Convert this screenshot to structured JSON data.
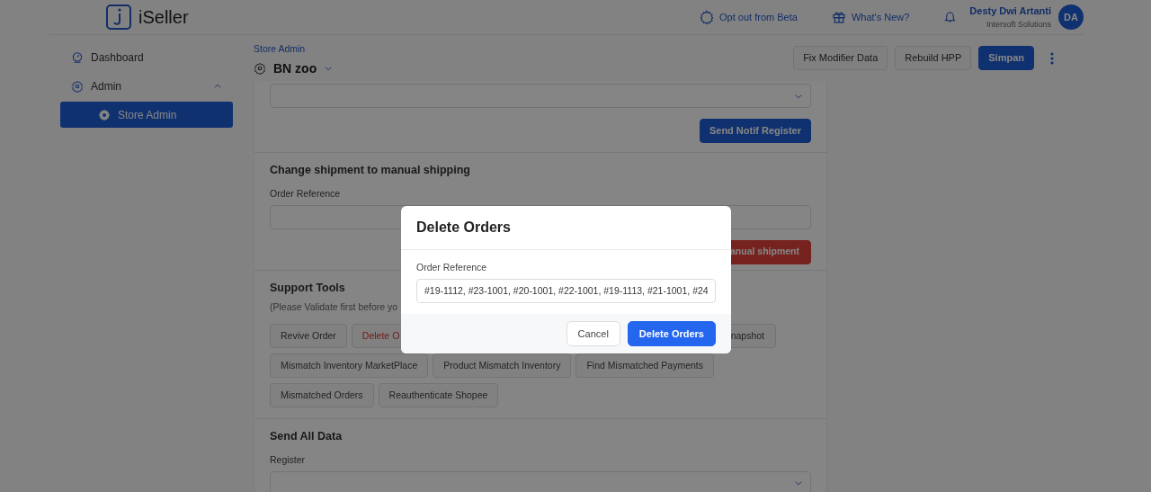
{
  "brand": {
    "name": "iSeller"
  },
  "topbar": {
    "links": [
      {
        "label": "Opt out from Beta"
      },
      {
        "label": "What's New?"
      }
    ],
    "user": {
      "name": "Desty Dwi Artanti",
      "company": "Intersoft Solutions",
      "initials": "DA"
    }
  },
  "sidebar": {
    "items": [
      {
        "label": "Dashboard",
        "selected": false
      },
      {
        "label": "Admin",
        "selected": false,
        "expanded": true,
        "children": [
          {
            "label": "Store Admin",
            "selected": true
          }
        ]
      }
    ]
  },
  "page": {
    "breadcrumb": "Store Admin",
    "store": "BN zoo",
    "actions": [
      {
        "label": "Fix Modifier Data",
        "kind": "secondary"
      },
      {
        "label": "Rebuild HPP",
        "kind": "secondary"
      },
      {
        "label": "Simpan",
        "kind": "primary"
      }
    ]
  },
  "sections": [
    {
      "kind": "select",
      "button": {
        "label": "Send Notif Register",
        "kind": "primary"
      }
    },
    {
      "kind": "field",
      "title": "Change shipment to manual shipping",
      "field_label": "Order Reference",
      "button": {
        "label": "anual shipment",
        "kind": "danger"
      }
    },
    {
      "kind": "tools",
      "title": "Support Tools",
      "note": "(Please Validate first before yo",
      "tools": [
        [
          {
            "label": "Revive Order",
            "kind": "default"
          },
          {
            "label": "Delete O",
            "kind": "danger"
          },
          {
            "label": "napshot",
            "kind": "default"
          }
        ],
        [
          {
            "label": "Mismatch Inventory MarketPlace",
            "kind": "default"
          },
          {
            "label": "Product Mismatch Inventory",
            "kind": "default"
          },
          {
            "label": "Find Mismatched Payments",
            "kind": "default"
          }
        ],
        [
          {
            "label": "Mismatched Orders",
            "kind": "default"
          },
          {
            "label": "Reauthenticate Shopee",
            "kind": "default"
          }
        ]
      ]
    },
    {
      "kind": "select",
      "title": "Send All Data",
      "field_label": "Register"
    }
  ],
  "modal": {
    "title": "Delete Orders",
    "field_label": "Order Reference",
    "value": "#19-1112, #23-1001, #20-1001, #22-1001, #19-1113, #21-1001, #24",
    "buttons": [
      {
        "label": "Cancel",
        "kind": "secondary"
      },
      {
        "label": "Delete Orders",
        "kind": "primary"
      }
    ]
  }
}
